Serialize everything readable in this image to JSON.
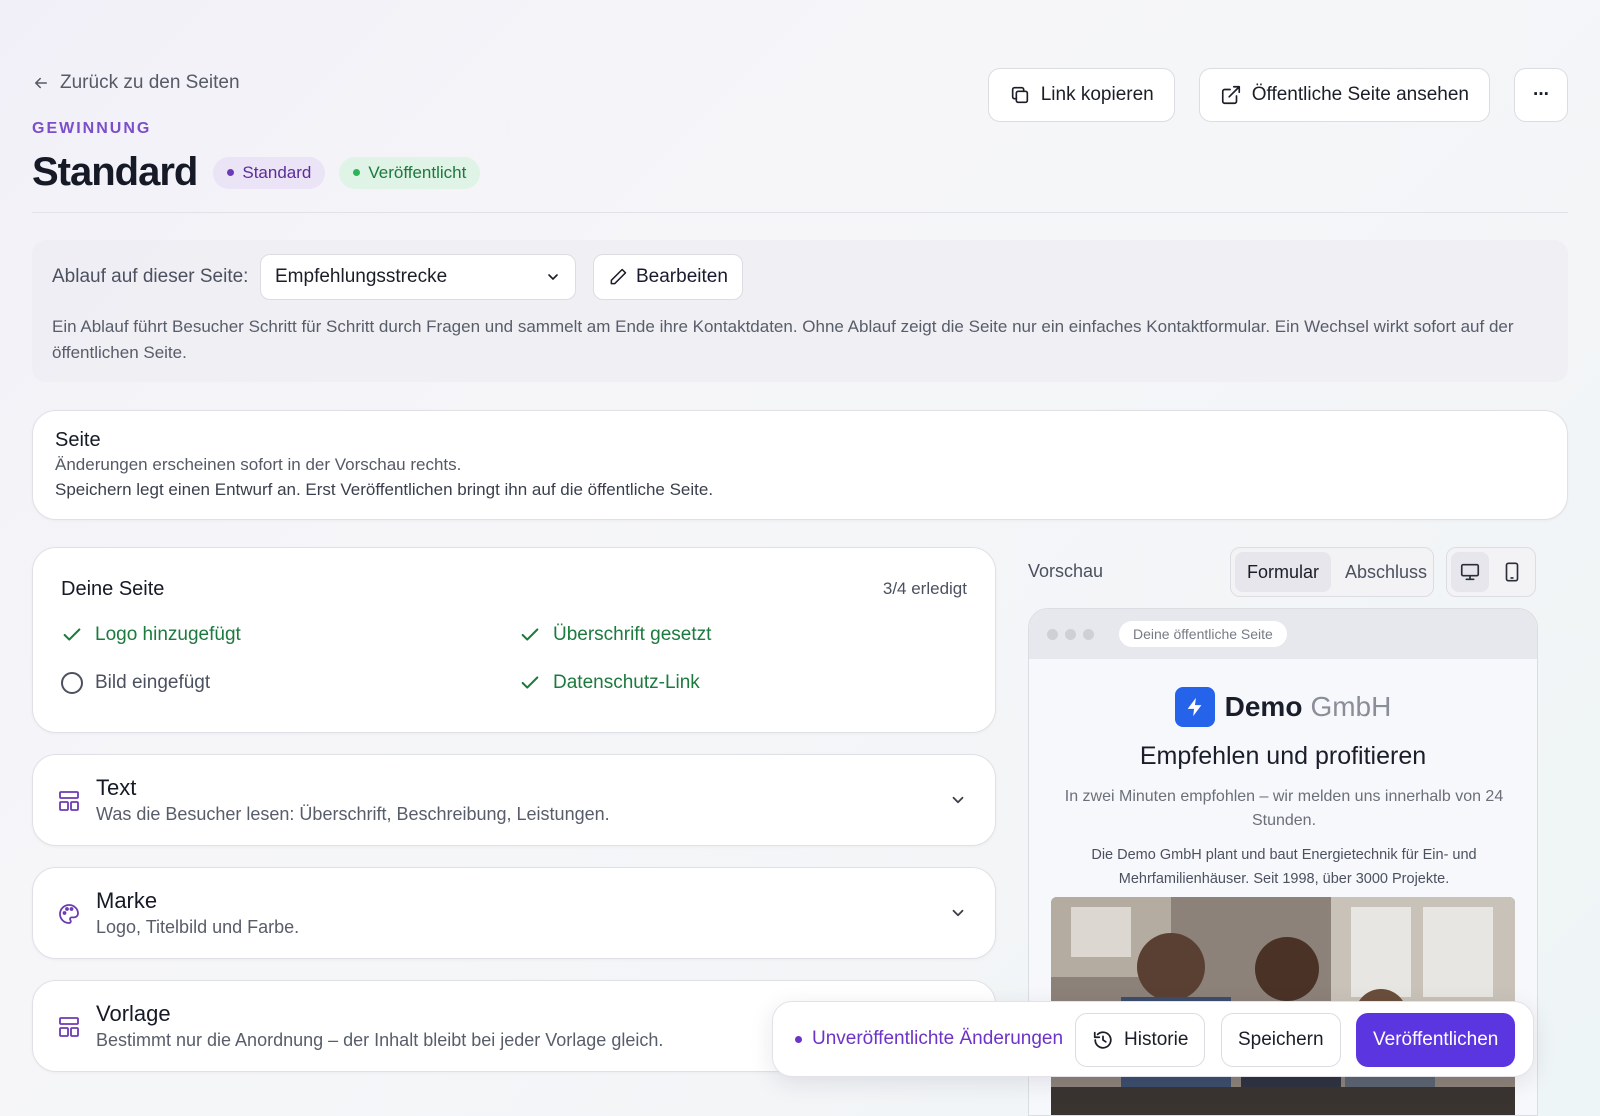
{
  "header": {
    "back_label": "Zurück zu den Seiten",
    "eyebrow": "GEWINNUNG",
    "title": "Standard",
    "badges": [
      {
        "label": "Standard"
      },
      {
        "label": "Veröffentlicht"
      }
    ],
    "actions": {
      "copy_link": "Link kopieren",
      "view_public": "Öffentliche Seite ansehen",
      "more": "···"
    }
  },
  "flow": {
    "label": "Ablauf auf dieser Seite:",
    "selected": "Empfehlungsstrecke",
    "edit_label": "Bearbeiten",
    "description": "Ein Ablauf führt Besucher Schritt für Schritt durch Fragen und sammelt am Ende ihre Kontaktdaten. Ohne Ablauf zeigt die Seite nur ein einfaches Kontaktformular. Ein Wechsel wirkt sofort auf der öffentlichen Seite."
  },
  "seite": {
    "title": "Seite",
    "line1": "Änderungen erscheinen sofort in der Vorschau rechts.",
    "line2": "Speichern legt einen Entwurf an. Erst Veröffentlichen bringt ihn auf die öffentliche Seite."
  },
  "checklist": {
    "title": "Deine Seite",
    "progress": "3/4 erledigt",
    "items": [
      {
        "label": "Logo hinzugefügt",
        "done": true
      },
      {
        "label": "Überschrift gesetzt",
        "done": true
      },
      {
        "label": "Bild eingefügt",
        "done": false
      },
      {
        "label": "Datenschutz-Link",
        "done": true
      }
    ]
  },
  "sections": [
    {
      "title": "Text",
      "description": "Was die Besucher lesen: Überschrift, Beschreibung, Leistungen.",
      "icon": "layout-icon"
    },
    {
      "title": "Marke",
      "description": "Logo, Titelbild und Farbe.",
      "icon": "palette-icon"
    },
    {
      "title": "Vorlage",
      "description": "Bestimmt nur die Anordnung – der Inhalt bleibt bei jeder Vorlage gleich.",
      "icon": "layout-icon"
    }
  ],
  "preview": {
    "label": "Vorschau",
    "tabs": [
      "Formular",
      "Abschluss"
    ],
    "active_tab": "Formular",
    "devices": [
      "desktop-icon",
      "mobile-icon"
    ],
    "url": "Deine öffentliche Seite",
    "brand_bold": "Demo",
    "brand_light": "GmbH",
    "heading": "Empfehlen und profitieren",
    "subheading": "In zwei Minuten empfohlen – wir melden uns innerhalb von 24 Stunden.",
    "description": "Die Demo GmbH plant und baut Energietechnik für Ein- und Mehrfamilienhäuser. Seit 1998, über 3000 Projekte."
  },
  "actionbar": {
    "status": "Unveröffentlichte Änderungen",
    "history": "Historie",
    "save": "Speichern",
    "publish": "Veröffentlichen"
  },
  "colors": {
    "accent": "#5b35e0",
    "eyebrow": "#7b4fc9",
    "success": "#1c7a3e",
    "logo_blue": "#2563eb"
  }
}
